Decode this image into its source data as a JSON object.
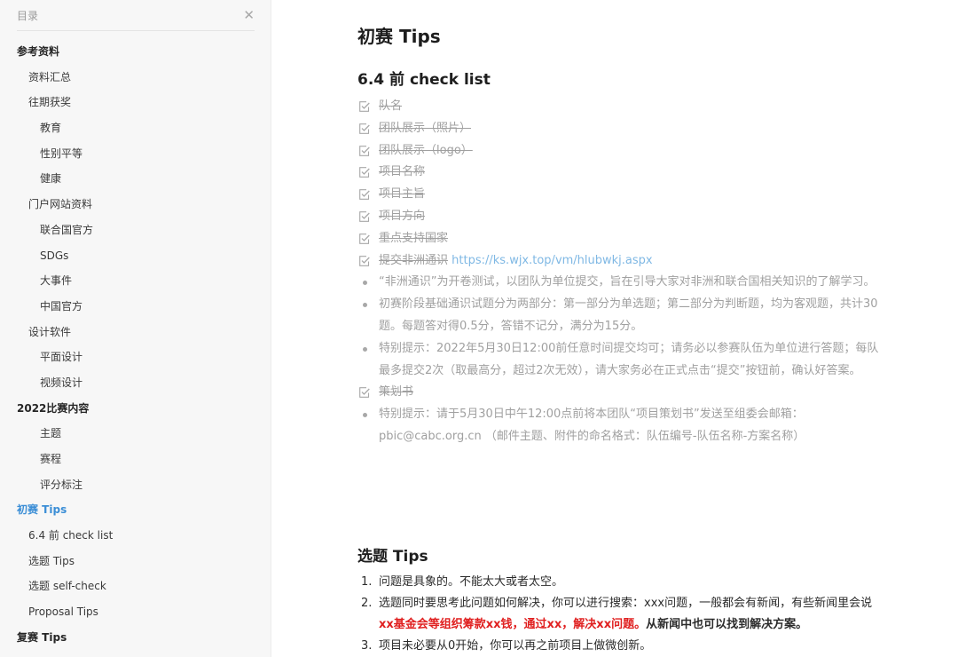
{
  "sidebar": {
    "title": "目录",
    "close_glyph": "✕",
    "items": [
      {
        "label": "参考资料",
        "level": 1
      },
      {
        "label": "资料汇总",
        "level": 2
      },
      {
        "label": "往期获奖",
        "level": 2
      },
      {
        "label": "教育",
        "level": 3
      },
      {
        "label": "性别平等",
        "level": 3
      },
      {
        "label": "健康",
        "level": 3
      },
      {
        "label": "门户网站资料",
        "level": 2
      },
      {
        "label": "联合国官方",
        "level": 3
      },
      {
        "label": "SDGs",
        "level": 3
      },
      {
        "label": "大事件",
        "level": 3
      },
      {
        "label": "中国官方",
        "level": 3
      },
      {
        "label": "设计软件",
        "level": 2
      },
      {
        "label": "平面设计",
        "level": 3
      },
      {
        "label": "视频设计",
        "level": 3
      },
      {
        "label": "2022比赛内容",
        "level": 1
      },
      {
        "label": "主题",
        "level": 3
      },
      {
        "label": "赛程",
        "level": 3
      },
      {
        "label": "评分标注",
        "level": 3
      },
      {
        "label": "初赛 Tips",
        "level": 1,
        "active": true
      },
      {
        "label": "6.4 前 check list",
        "level": 2
      },
      {
        "label": "选题 Tips",
        "level": 2
      },
      {
        "label": "选题 self-check",
        "level": 2
      },
      {
        "label": "Proposal Tips",
        "level": 2
      },
      {
        "label": "复赛 Tips",
        "level": 1
      }
    ]
  },
  "main": {
    "h1": "初赛 Tips",
    "h2_checklist": "6.4 前 check list",
    "checklist": [
      {
        "type": "check",
        "text": "队名"
      },
      {
        "type": "check",
        "text": "团队展示（照片）"
      },
      {
        "type": "check",
        "text": "团队展示（logo）"
      },
      {
        "type": "check",
        "text": "项目名称"
      },
      {
        "type": "check",
        "text": "项目主旨"
      },
      {
        "type": "check",
        "text": "项目方向"
      },
      {
        "type": "check",
        "text": "重点支持国家"
      },
      {
        "type": "check",
        "text": "提交非洲通识",
        "link": "https://ks.wjx.top/vm/hlubwkj.aspx"
      },
      {
        "type": "bullet",
        "text": "“非洲通识”为开卷测试，以团队为单位提交，旨在引导大家对非洲和联合国相关知识的了解学习。"
      },
      {
        "type": "bullet",
        "text": "初赛阶段基础通识试题分为两部分：第一部分为单选题；第二部分为判断题，均为客观题，共计30题。每题答对得0.5分，答错不记分，满分为15分。"
      },
      {
        "type": "bullet",
        "text": "特别提示：2022年5月30日12:00前任意时间提交均可；请务必以参赛队伍为单位进行答题；每队最多提交2次（取最高分，超过2次无效），请大家务必在正式点击“提交”按钮前，确认好答案。"
      },
      {
        "type": "check",
        "text": "策划书"
      },
      {
        "type": "bullet",
        "text": "特别提示：请于5月30日中午12:00点前将本团队“项目策划书”发送至组委会邮箱：pbic@cabc.org.cn （邮件主题、附件的命名格式：队伍编号-队伍名称-方案名称）"
      }
    ],
    "h2_topic": "选题 Tips",
    "topic_list": [
      {
        "num": "1.",
        "text": "问题是具象的。不能太大或者太空。"
      },
      {
        "num": "2.",
        "text_a": "选题同时要思考此问题如何解决，你可以进行搜索：xxx问题，一般都会有新闻，有些新闻里会说",
        "text_red": "xx基金会等组织筹款xx钱，通过xx，解决xx问题。",
        "text_bold": "从新闻中也可以找到解决方案。"
      },
      {
        "num": "3.",
        "text": "项目未必要从0开始，你可以再之前项目上做微创新。"
      }
    ]
  },
  "colors": {
    "active": "#3b8ed6",
    "muted": "#a0a0a0",
    "link": "#7fb8e4",
    "red": "#e02020"
  }
}
